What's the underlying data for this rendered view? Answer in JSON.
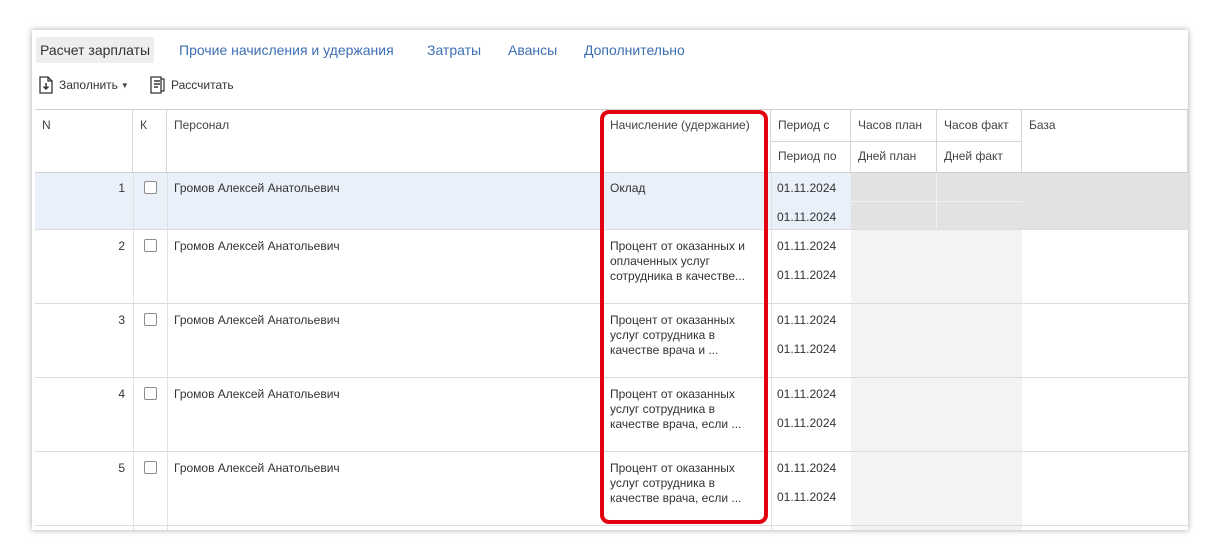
{
  "tabs": [
    {
      "label": "Расчет зарплаты",
      "active": true
    },
    {
      "label": "Прочие начисления и удержания",
      "active": false
    },
    {
      "label": "Затраты",
      "active": false
    },
    {
      "label": "Авансы",
      "active": false
    },
    {
      "label": "Дополнительно",
      "active": false
    }
  ],
  "toolbar": {
    "fill_label": "Заполнить",
    "calc_label": "Рассчитать"
  },
  "columns": {
    "n": "N",
    "k": "К",
    "personnel": "Персонал",
    "accrual": "Начисление (удержание)",
    "period_from": "Период с",
    "period_to": "Период по",
    "hours_plan": "Часов план",
    "days_plan": "Дней план",
    "hours_fact": "Часов факт",
    "days_fact": "Дней факт",
    "base": "База"
  },
  "rows": [
    {
      "n": "1",
      "person": "Громов Алексей Анатольевич",
      "accrual": "Оклад",
      "from": "01.11.2024",
      "to": "01.11.2024"
    },
    {
      "n": "2",
      "person": "Громов Алексей Анатольевич",
      "accrual": "Процент от оказанных и оплаченных услуг сотрудника в качестве...",
      "from": "01.11.2024",
      "to": "01.11.2024"
    },
    {
      "n": "3",
      "person": "Громов Алексей Анатольевич",
      "accrual": "Процент от оказанных услуг сотрудника в качестве врача и ...",
      "from": "01.11.2024",
      "to": "01.11.2024"
    },
    {
      "n": "4",
      "person": "Громов Алексей Анатольевич",
      "accrual": "Процент от оказанных услуг сотрудника в качестве врача, если ...",
      "from": "01.11.2024",
      "to": "01.11.2024"
    },
    {
      "n": "5",
      "person": "Громов Алексей Анатольевич",
      "accrual": "Процент от оказанных услуг сотрудника в качестве врача, если ...",
      "from": "01.11.2024",
      "to": "01.11.2024"
    }
  ],
  "colors": {
    "link": "#3d6fb3",
    "selected_row": "#e9f0fa",
    "highlight": "#e3000f"
  }
}
